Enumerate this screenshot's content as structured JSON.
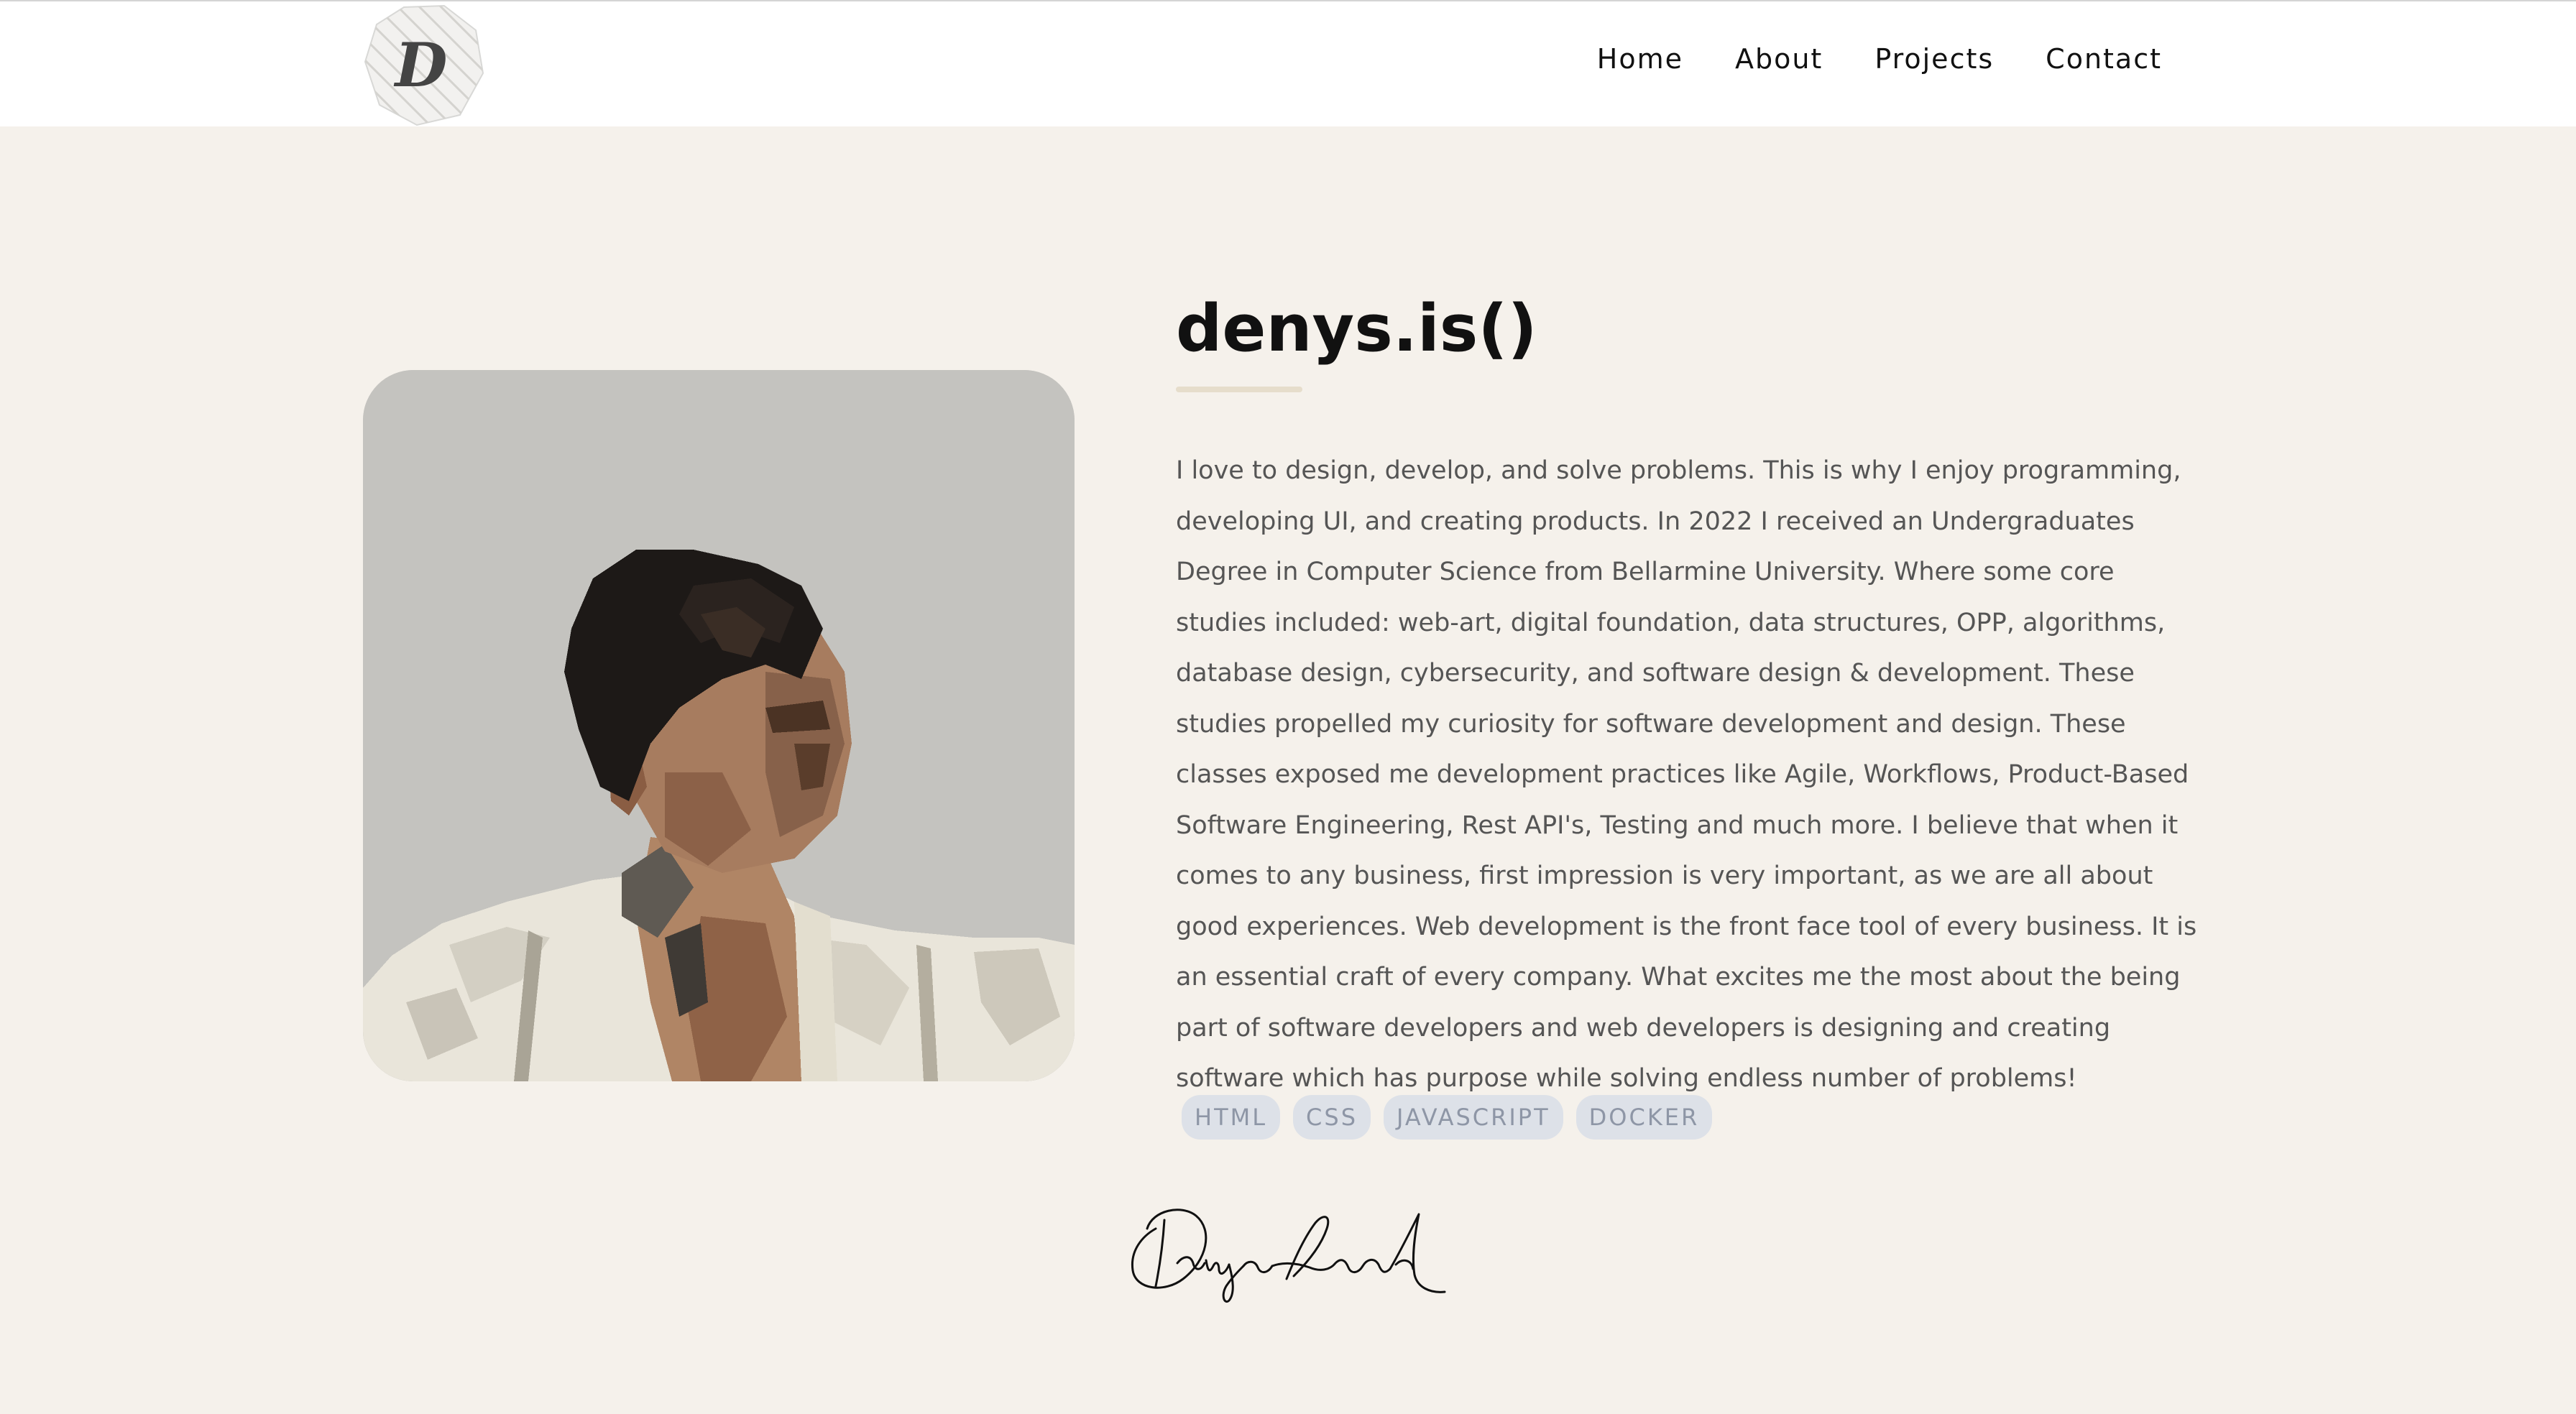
{
  "nav": {
    "logo_letter": "D",
    "links": [
      "Home",
      "About",
      "Projects",
      "Contact"
    ]
  },
  "hero": {
    "title": "denys.is()",
    "bio": "I love to design, develop, and solve problems. This is why I enjoy programming, developing UI, and creating products. In 2022 I received an Undergraduates Degree in Computer Science from Bellarmine University. Where some core studies included: web-art, digital foundation, data structures, OPP, algorithms, database design, cybersecurity, and software design & development. These studies propelled my curiosity for software development and design. These classes exposed me development practices like Agile, Workflows, Product-Based Software Engineering, Rest API's, Testing and much more. I believe that when it comes to any business, first impression is very important, as we are all about good experiences. Web development is the front face tool of every business. It is an essential craft of every company. What excites me the most about the being part of software developers and web developers is designing and creating software which has purpose while solving endless number of problems!",
    "tags": [
      "HTML",
      "CSS",
      "JAVASCRIPT",
      "DOCKER"
    ]
  },
  "colors": {
    "background": "#f5f1eb",
    "navbar": "#ffffff",
    "tag_bg": "#dde1e8",
    "tag_text": "#8e96a6",
    "underline": "#e6ddcb"
  }
}
